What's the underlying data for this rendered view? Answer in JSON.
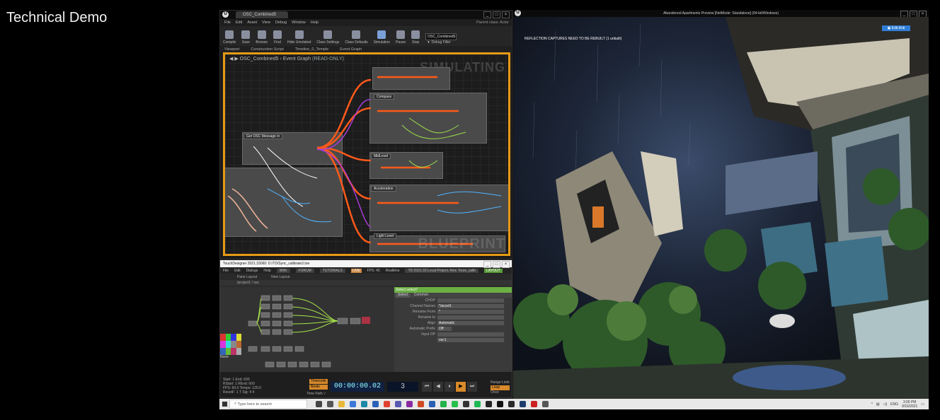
{
  "slide": {
    "title": "Technical Demo"
  },
  "unreal_editor": {
    "tab_title": "OSC_Combined5",
    "menu": [
      "File",
      "Edit",
      "Asset",
      "View",
      "Debug",
      "Window",
      "Help"
    ],
    "context_label": "Parent class: Actor",
    "toolbar": [
      {
        "label": "Compile",
        "icon": "compile-icon"
      },
      {
        "label": "Save",
        "icon": "save-icon"
      },
      {
        "label": "Browse",
        "icon": "browse-icon"
      },
      {
        "label": "Find",
        "icon": "find-icon"
      },
      {
        "label": "Hide Unrelated",
        "icon": "hide-unrelated-icon"
      },
      {
        "label": "Class Settings",
        "icon": "class-settings-icon"
      },
      {
        "label": "Class Defaults",
        "icon": "class-defaults-icon"
      },
      {
        "label": "Simulation",
        "icon": "simulation-icon"
      },
      {
        "label": "Pause",
        "icon": "pause-icon"
      },
      {
        "label": "Stop",
        "icon": "stop-icon"
      }
    ],
    "debug_filter": {
      "value": "OSC_Combined5 ▾",
      "label": "Debug Filter"
    },
    "sub_tabs": [
      "Viewport",
      "Construction Script",
      "Timeline_0_Temple",
      "Event Graph"
    ],
    "breadcrumb": {
      "asset": "OSC_Combined5",
      "graph": "Event Graph",
      "status": "(READ-ONLY)"
    },
    "watermark_top": "SIMULATING",
    "watermark_bottom": "BLUEPRINT",
    "node_labels": [
      "Compass",
      "Get OSC Message in",
      "MidLevel",
      "Acceleration",
      "Light Level"
    ]
  },
  "touchdesigner": {
    "window_title": "TouchDesigner 2021.33060: D:/TD/Sync_calibrate3.toe",
    "menu": [
      "File",
      "Edit",
      "Dialogs",
      "Help"
    ],
    "menu_tags": [
      "WIKI",
      "FORUM",
      "TUTORIALS"
    ],
    "highlight_tag": "LIVE",
    "fps_label": "FPS: 45",
    "realtime_label": "Realtime",
    "license_label": "TD 2021.33 Local Project, Amc Tours_calib",
    "green_tag": "LAYOUT",
    "layouts": [
      "Pane Layout",
      "New Layout"
    ],
    "network_path": "/project1 / osc",
    "params": {
      "header": "Select  select7",
      "tabs": [
        "Select",
        "Common"
      ],
      "rows": [
        {
          "label": "CHOP",
          "value": ""
        },
        {
          "label": "Channel Names",
          "value": "*/accel1"
        },
        {
          "label": "Rename From",
          "value": "*"
        },
        {
          "label": "Rename to",
          "value": ""
        },
        {
          "label": "Align",
          "value": "Automatic"
        },
        {
          "label": "Automatic Prefix",
          "value": "Off"
        },
        {
          "label": "Input OP",
          "value": ""
        },
        {
          "label": "",
          "value": "osc1"
        }
      ]
    },
    "palette_label": "None",
    "stats": [
      "Start:   1      End:     600",
      "RStart:  1      REnd:    600",
      "FPS:   60.0     Tempo:  120.0",
      "ResetF:  1      T Sig:  4    4"
    ],
    "timecode": "00:00:00.02",
    "frame": "3",
    "timecode_labels": [
      "Timecode",
      "Beats"
    ],
    "time_path": "Time Path: /",
    "transport": [
      "⏮",
      "◀",
      "⏸",
      "▶",
      "⏭"
    ],
    "range_labels": [
      "Range Limit",
      "Loop",
      "Once"
    ]
  },
  "viewport": {
    "title": "Abandoned Apartments Preview [NetMode: Standalone] (64-bit/Windows)",
    "message": "REFLECTION CAPTURES NEED TO BE REBUILT (1 unbuilt)",
    "badge": "▣ Edit.Anti"
  },
  "taskbar": {
    "search_placeholder": "Type here to search",
    "app_icons": [
      {
        "name": "cortana-icon",
        "color": "#444444"
      },
      {
        "name": "task-view-icon",
        "color": "#555555"
      },
      {
        "name": "file-explorer-icon",
        "color": "#e8b838"
      },
      {
        "name": "store-icon",
        "color": "#3c78d8"
      },
      {
        "name": "edge-icon",
        "color": "#1e88a8"
      },
      {
        "name": "mail-icon",
        "color": "#2a62b8"
      },
      {
        "name": "chrome-icon",
        "color": "#e04030"
      },
      {
        "name": "teams-icon",
        "color": "#5859b0"
      },
      {
        "name": "onenote-icon",
        "color": "#8a2ba0"
      },
      {
        "name": "powerpoint-icon",
        "color": "#d04a24"
      },
      {
        "name": "word-icon",
        "color": "#2b5fb4"
      },
      {
        "name": "line-icon",
        "color": "#22b34a"
      },
      {
        "name": "whatsapp-icon",
        "color": "#26c04b"
      },
      {
        "name": "security-icon",
        "color": "#333333"
      },
      {
        "name": "spotify-icon",
        "color": "#1db954"
      },
      {
        "name": "touchdesigner-icon",
        "color": "#222222"
      },
      {
        "name": "unreal-icon",
        "color": "#111111"
      },
      {
        "name": "obs-icon",
        "color": "#2a2a2a"
      },
      {
        "name": "photoshop-icon",
        "color": "#1c3c6c"
      },
      {
        "name": "record-icon",
        "color": "#cc2020"
      },
      {
        "name": "settings-icon",
        "color": "#555555"
      }
    ],
    "tray_lang": "ENG",
    "time": "3:00 PM",
    "date": "9/16/2021"
  },
  "colors": {
    "graph_border": "#e59a15",
    "td_green": "#6bb043",
    "timecode_bg": "#102040",
    "wire_orange": "#ff5a1a"
  }
}
